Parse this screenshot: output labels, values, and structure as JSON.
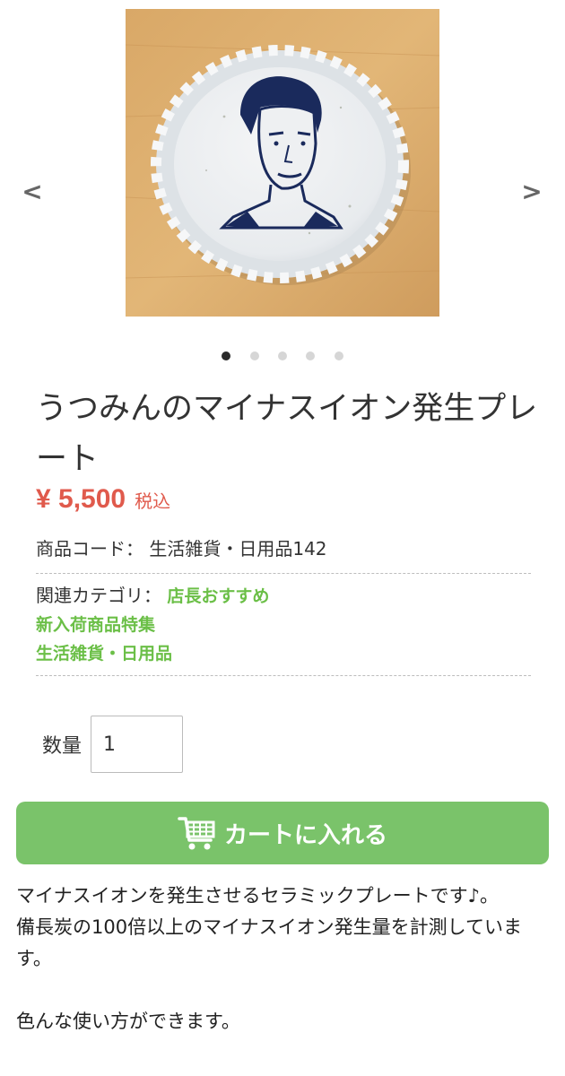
{
  "gallery": {
    "prev_icon": "chevron-left-icon",
    "next_icon": "chevron-right-icon",
    "prev_glyph": "<",
    "next_glyph": ">",
    "image_alt": "Ceramic plate with portrait",
    "active_index": 0,
    "slide_count": 5
  },
  "product": {
    "title": "うつみんのマイナスイオン発生プレート",
    "price": "¥ 5,500",
    "tax_label": "税込",
    "code_label": "商品コード：",
    "code_value": "生活雑貨・日用品142",
    "category_label": "関連カテゴリ：",
    "categories": [
      "店長おすすめ",
      "新入荷商品特集",
      "生活雑貨・日用品"
    ]
  },
  "quantity": {
    "label": "数量",
    "value": "1"
  },
  "cart": {
    "label": "カートに入れる",
    "icon": "cart-icon"
  },
  "description": {
    "lines": [
      "マイナスイオンを発生させるセラミックプレートです♪。",
      "備長炭の100倍以上のマイナスイオン発生量を計測しています。",
      "",
      "色んな使い方ができます。"
    ]
  },
  "colors": {
    "price": "#e05a4c",
    "accent_green": "#7ac36a",
    "link_green": "#6bbf47",
    "dot_active": "#2b2b2b",
    "dot_inactive": "#d6d6d6"
  }
}
